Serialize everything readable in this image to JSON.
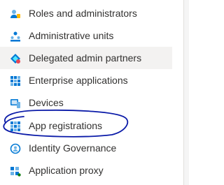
{
  "nav": {
    "items": [
      {
        "label": "Roles and administrators",
        "icon": "roles-icon"
      },
      {
        "label": "Administrative units",
        "icon": "admin-units-icon"
      },
      {
        "label": "Delegated admin partners",
        "icon": "partners-icon"
      },
      {
        "label": "Enterprise applications",
        "icon": "enterprise-apps-icon"
      },
      {
        "label": "Devices",
        "icon": "devices-icon"
      },
      {
        "label": "App registrations",
        "icon": "app-registrations-icon"
      },
      {
        "label": "Identity Governance",
        "icon": "identity-governance-icon"
      },
      {
        "label": "Application proxy",
        "icon": "application-proxy-icon"
      }
    ],
    "highlighted_item": "Delegated admin partners",
    "circled_item": "App registrations"
  },
  "colors": {
    "azure_blue": "#0078d4",
    "hover_bg": "#f3f2f1",
    "text": "#323130",
    "annotation_ink": "#0a1aa8"
  }
}
